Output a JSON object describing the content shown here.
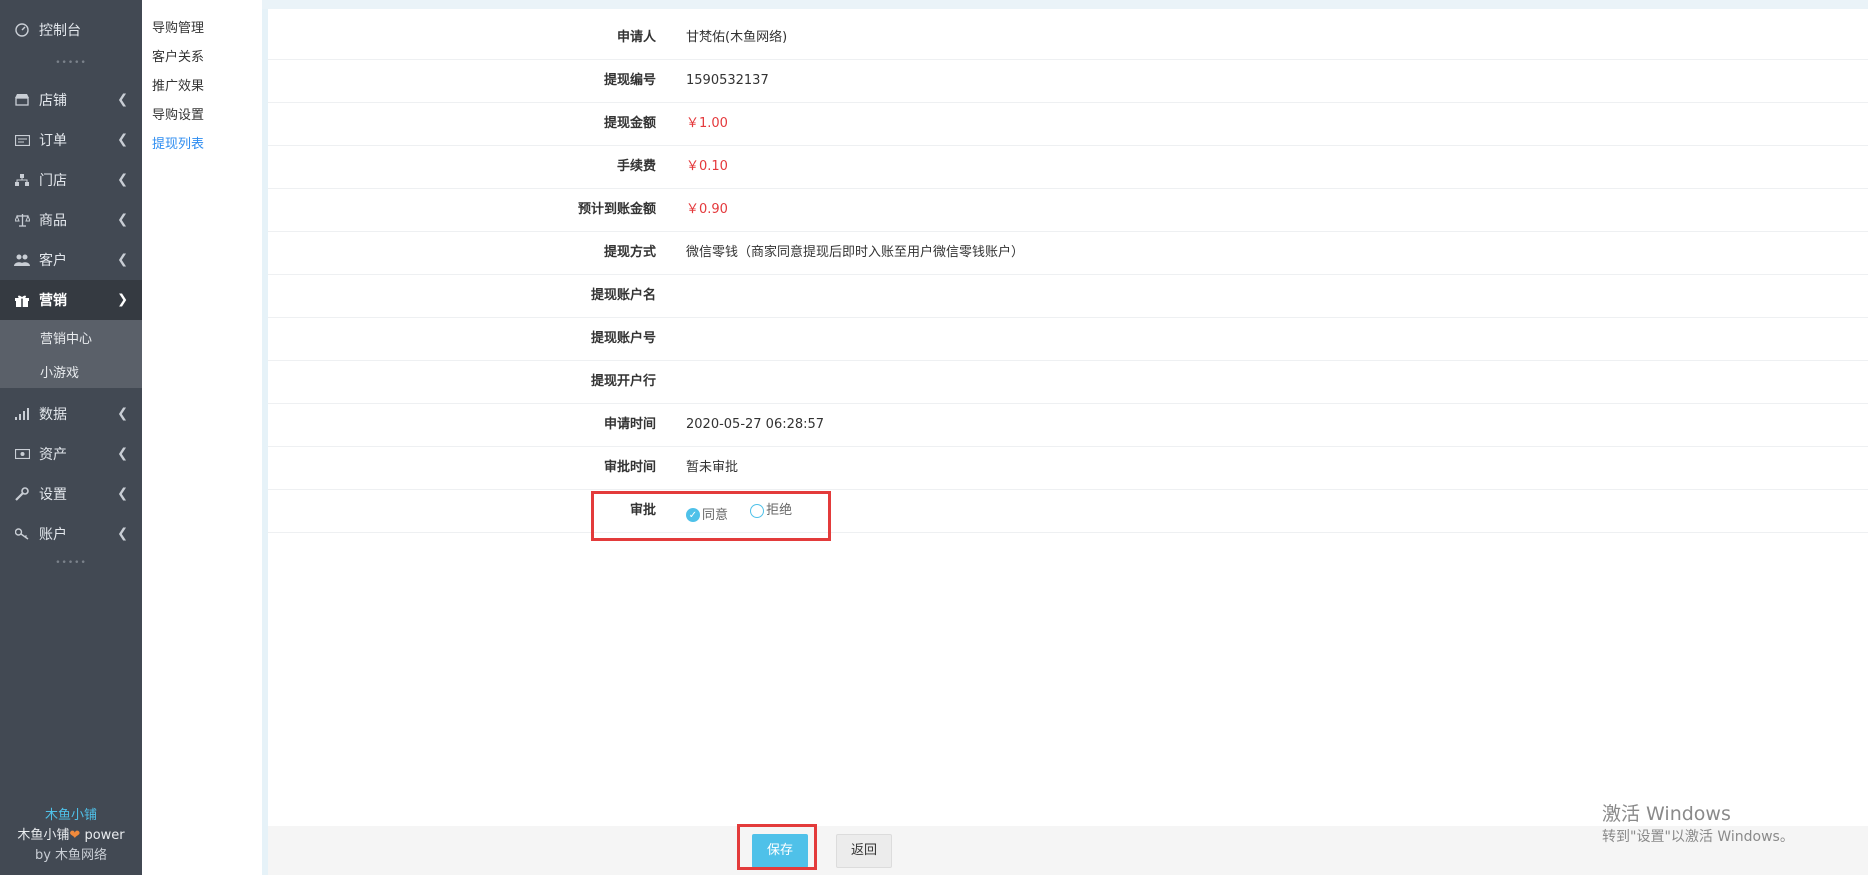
{
  "sidebar": {
    "dashboard": "控制台",
    "items": [
      {
        "label": "店铺",
        "icon": "shop-icon"
      },
      {
        "label": "订单",
        "icon": "order-icon"
      },
      {
        "label": "门店",
        "icon": "store-icon"
      },
      {
        "label": "商品",
        "icon": "scale-icon"
      },
      {
        "label": "客户",
        "icon": "users-icon"
      },
      {
        "label": "营销",
        "icon": "gift-icon"
      },
      {
        "label": "数据",
        "icon": "signal-icon"
      },
      {
        "label": "资产",
        "icon": "money-icon"
      },
      {
        "label": "设置",
        "icon": "wrench-icon"
      },
      {
        "label": "账户",
        "icon": "key-icon"
      }
    ],
    "marketing_sub": [
      "营销中心",
      "小游戏"
    ],
    "footer": {
      "brand": "木鱼小铺",
      "power": "木鱼小铺",
      "power_suffix": "power",
      "by": "by 木鱼网络"
    }
  },
  "submenu": {
    "items": [
      "导购管理",
      "客户关系",
      "推广效果",
      "导购设置",
      "提现列表"
    ],
    "active_index": 4
  },
  "form": {
    "rows": [
      {
        "label": "申请人",
        "value": "甘梵佑(木鱼网络)"
      },
      {
        "label": "提现编号",
        "value": "1590532137"
      },
      {
        "label": "提现金额",
        "value": "￥1.00"
      },
      {
        "label": "手续费",
        "value": "￥0.10"
      },
      {
        "label": "预计到账金额",
        "value": "￥0.90"
      },
      {
        "label": "提现方式",
        "value": "微信零钱（商家同意提现后即时入账至用户微信零钱账户）"
      },
      {
        "label": "提现账户名",
        "value": ""
      },
      {
        "label": "提现账户号",
        "value": ""
      },
      {
        "label": "提现开户行",
        "value": ""
      },
      {
        "label": "申请时间",
        "value": "2020-05-27 06:28:57"
      },
      {
        "label": "审批时间",
        "value": "暂未审批"
      }
    ],
    "approval": {
      "label": "审批",
      "options": [
        "同意",
        "拒绝"
      ],
      "selected": "同意"
    }
  },
  "actions": {
    "save": "保存",
    "back": "返回"
  },
  "watermark": {
    "title": "激活 Windows",
    "subtitle": "转到\"设置\"以激活 Windows。"
  },
  "colors": {
    "accent": "#4fc1e9",
    "sidebar": "#424953",
    "highlight": "#e33b3b",
    "price": "#e4393c"
  }
}
